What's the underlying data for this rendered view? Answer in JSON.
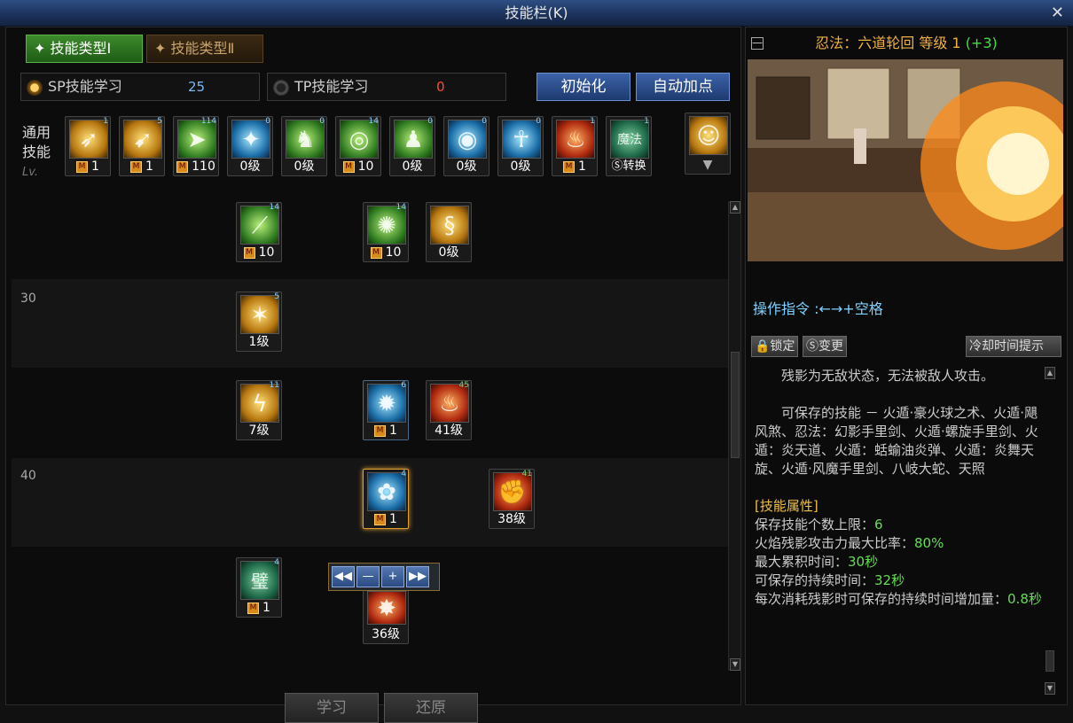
{
  "window": {
    "title": "技能栏(K)",
    "close": "✕"
  },
  "tabs": [
    "✦ 技能类型Ⅰ",
    "✦ 技能类型Ⅱ"
  ],
  "points": {
    "sp_label": "SP技能学习",
    "sp_value": "25",
    "tp_label": "TP技能学习",
    "tp_value": "0"
  },
  "buttons": {
    "reset": "初始化",
    "auto": "自动加点",
    "learn": "学习",
    "restore": "还原"
  },
  "general": {
    "label": "通用技能",
    "lv": "Lv."
  },
  "general_skills": [
    {
      "num": "1",
      "level": "1",
      "mastered": true
    },
    {
      "num": "5",
      "level": "1",
      "mastered": true
    },
    {
      "num": "114",
      "level": "110",
      "mastered": true
    },
    {
      "num": "0",
      "level": "0级",
      "mastered": false
    },
    {
      "num": "0",
      "level": "0级",
      "mastered": false
    },
    {
      "num": "14",
      "level": "10",
      "mastered": true
    },
    {
      "num": "0",
      "level": "0级",
      "mastered": false
    },
    {
      "num": "0",
      "level": "0级",
      "mastered": false
    },
    {
      "num": "0",
      "level": "0级",
      "mastered": false
    },
    {
      "num": "1",
      "level": "1",
      "mastered": true
    },
    {
      "num": "1",
      "level": "Ⓢ转换",
      "mastered": false
    }
  ],
  "tree": {
    "row_labels": [
      "30",
      "40"
    ],
    "skills": [
      {
        "num": "14",
        "level": "10",
        "mastered": true
      },
      {
        "num": "14",
        "level": "10",
        "mastered": true
      },
      {
        "num": "",
        "level": "0级",
        "mastered": false
      },
      {
        "num": "5",
        "level": "1级",
        "mastered": false
      },
      {
        "num": "11",
        "level": "7级",
        "mastered": false
      },
      {
        "num": "6",
        "level": "1",
        "mastered": true
      },
      {
        "num": "45",
        "level": "41级",
        "mastered": false
      },
      {
        "num": "4",
        "level": "1",
        "mastered": true
      },
      {
        "num": "41",
        "level": "38级",
        "mastered": false
      },
      {
        "num": "4",
        "level": "1",
        "mastered": true
      },
      {
        "num": "",
        "level": "36级",
        "mastered": false
      }
    ]
  },
  "stepper": [
    "◀◀",
    "—",
    "+",
    "▶▶"
  ],
  "detail": {
    "minimize": "—",
    "skill_name": "忍法：六道轮回 等级 1",
    "bonus": "(+3)",
    "command": "操作指令 :←→+空格",
    "lock": "🔒锁定",
    "change": "Ⓢ变更",
    "cooldown": "冷却时间提示",
    "desc1": "残影为无敌状态，无法被敌人攻击。",
    "desc2": "可保存的技能 － 火遁·豪火球之术、火遁·飓风煞、忍法：幻影手里剑、火遁·螺旋手里剑、火遁：炎天道、火遁：蛞蝓油炎弹、火遁：炎舞天旋、火遁·风魔手里剑、八岐大蛇、天照",
    "attr_title": "[技能属性]",
    "attrs": [
      {
        "label": "保存技能个数上限：",
        "value": "6"
      },
      {
        "label": "火焰残影攻击力最大比率：",
        "value": "80%"
      },
      {
        "label": "最大累积时间：",
        "value": "30秒"
      },
      {
        "label": "可保存的持续时间：",
        "value": "32秒"
      },
      {
        "label": "每次消耗残影时可保存的持续时间增加量：",
        "value": "0.8秒"
      }
    ]
  }
}
